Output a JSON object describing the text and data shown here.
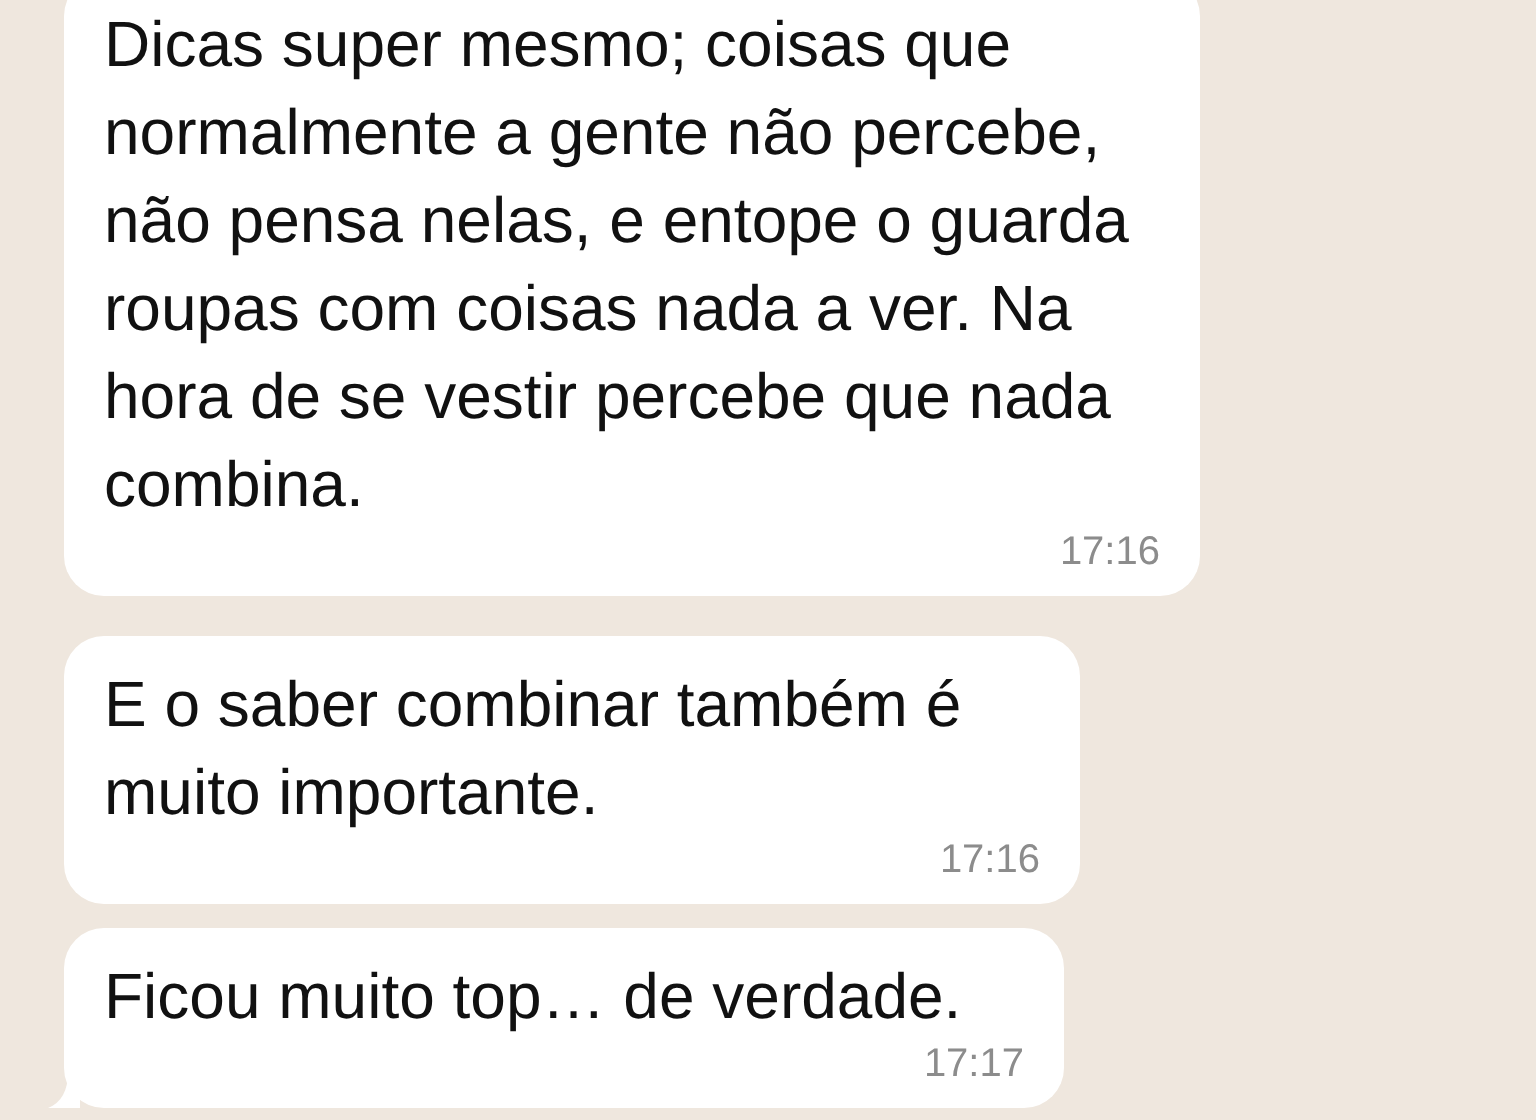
{
  "messages": [
    {
      "text": "Dicas super mesmo; coisas que normalmente a gente não percebe, não pensa nelas, e entope o guarda roupas com coisas nada a ver. Na hora de se vestir percebe que nada combina.",
      "time": "17:16",
      "tail": false
    },
    {
      "text": "E o saber combinar também é muito importante.",
      "time": "17:16",
      "tail": false
    },
    {
      "text": "Ficou muito top… de verdade.",
      "time": "17:17",
      "tail": true
    }
  ]
}
